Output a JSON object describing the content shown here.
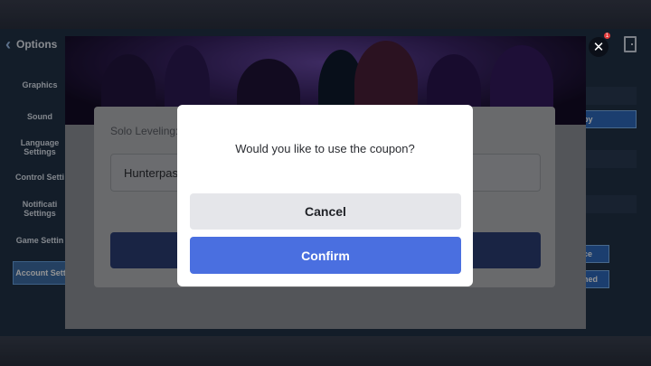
{
  "settings": {
    "header_title": "Options",
    "sidebar": [
      {
        "label": "Graphics"
      },
      {
        "label": "Sound"
      },
      {
        "label": "Language Settings"
      },
      {
        "label": "Control Setti"
      },
      {
        "label": "Notificati Settings"
      },
      {
        "label": "Game Settin"
      },
      {
        "label": "Account Sett"
      }
    ],
    "right_buttons": {
      "copy": "py",
      "btn2": "ce",
      "btn3": "ned"
    },
    "notification_count": "1"
  },
  "coupon": {
    "title": "Solo Leveling:",
    "input_value": "Hunterpass"
  },
  "modal": {
    "message": "Would you like to use the coupon?",
    "cancel_label": "Cancel",
    "confirm_label": "Confirm"
  },
  "colors": {
    "accent": "#4a6fe0",
    "cancel_bg": "#e5e6ea",
    "modal_bg": "#ffffff"
  }
}
